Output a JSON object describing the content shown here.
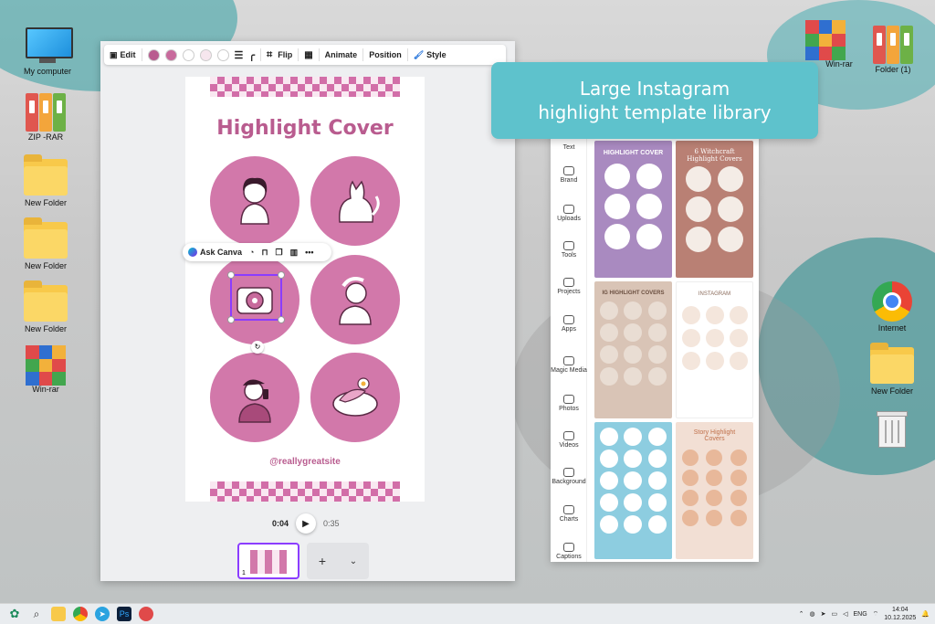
{
  "desktop": {
    "icons_left": [
      {
        "label": "My computer",
        "icon": "computer-icon"
      },
      {
        "label": "ZIP -RAR",
        "icon": "binders-icon"
      },
      {
        "label": "New Folder",
        "icon": "folder-icon"
      },
      {
        "label": "New Folder",
        "icon": "folder-icon"
      },
      {
        "label": "New Folder",
        "icon": "folder-icon"
      },
      {
        "label": "Win-rar",
        "icon": "winrar-icon"
      }
    ],
    "icons_right": [
      {
        "label": "Win-rar",
        "icon": "winrar-icon"
      },
      {
        "label": "Folder (1)",
        "icon": "binders-icon"
      },
      {
        "label": "Internet",
        "icon": "chrome-icon"
      },
      {
        "label": "New Folder",
        "icon": "folder-icon"
      },
      {
        "label": "",
        "icon": "recycle-bin-icon"
      }
    ]
  },
  "toolbar": {
    "edit_label": "Edit",
    "flip_label": "Flip",
    "animate_label": "Animate",
    "position_label": "Position",
    "style_label": "Style",
    "swatches": [
      "#b95c8f",
      "#c86a9c",
      "#ffffff",
      "#f6e6ee",
      "#ffffff"
    ]
  },
  "design": {
    "title": "Highlight Cover",
    "handle": "@reallygreatsite",
    "accent": "#d278aa"
  },
  "context_bar": {
    "ask_label": "Ask Canva"
  },
  "playback": {
    "current": "0:04",
    "total": "0:35"
  },
  "pages": {
    "page_number": "1",
    "add_label": "+",
    "chevron": "⌄"
  },
  "callout": {
    "line1": "Large Instagram",
    "line2": "highlight template library",
    "color": "#5ec2cc"
  },
  "rail": [
    {
      "label": "Text"
    },
    {
      "label": "Brand"
    },
    {
      "label": "Uploads"
    },
    {
      "label": "Tools"
    },
    {
      "label": "Projects"
    },
    {
      "label": "Apps"
    },
    {
      "label": "Magic Media"
    },
    {
      "label": "Photos"
    },
    {
      "label": "Videos"
    },
    {
      "label": "Background"
    },
    {
      "label": "Charts"
    },
    {
      "label": "Captions"
    }
  ],
  "templates": [
    {
      "title": "HIGHLIGHT COVER",
      "bg": "#a98ac0",
      "dot": "#ffffff"
    },
    {
      "title": "6 Witchcraft Highlight Covers",
      "bg": "#b98074",
      "dot": "#f4ece6"
    },
    {
      "title": "IG HIGHLIGHT COVERS",
      "bg": "#d9c4b6",
      "dot": "#e9ddd3"
    },
    {
      "title": "INSTAGRAM",
      "bg": "#ffffff",
      "dot": "#f4e6dc"
    },
    {
      "title": "",
      "bg": "#8dcde0",
      "dot": "#ffffff"
    },
    {
      "title": "Story Highlight Covers",
      "bg": "#f2dfd4",
      "dot": "#e8b89a"
    }
  ],
  "taskbar": {
    "lang": "ENG",
    "time": "14:04",
    "date": "10.12.2025",
    "ps_label": "Ps"
  }
}
